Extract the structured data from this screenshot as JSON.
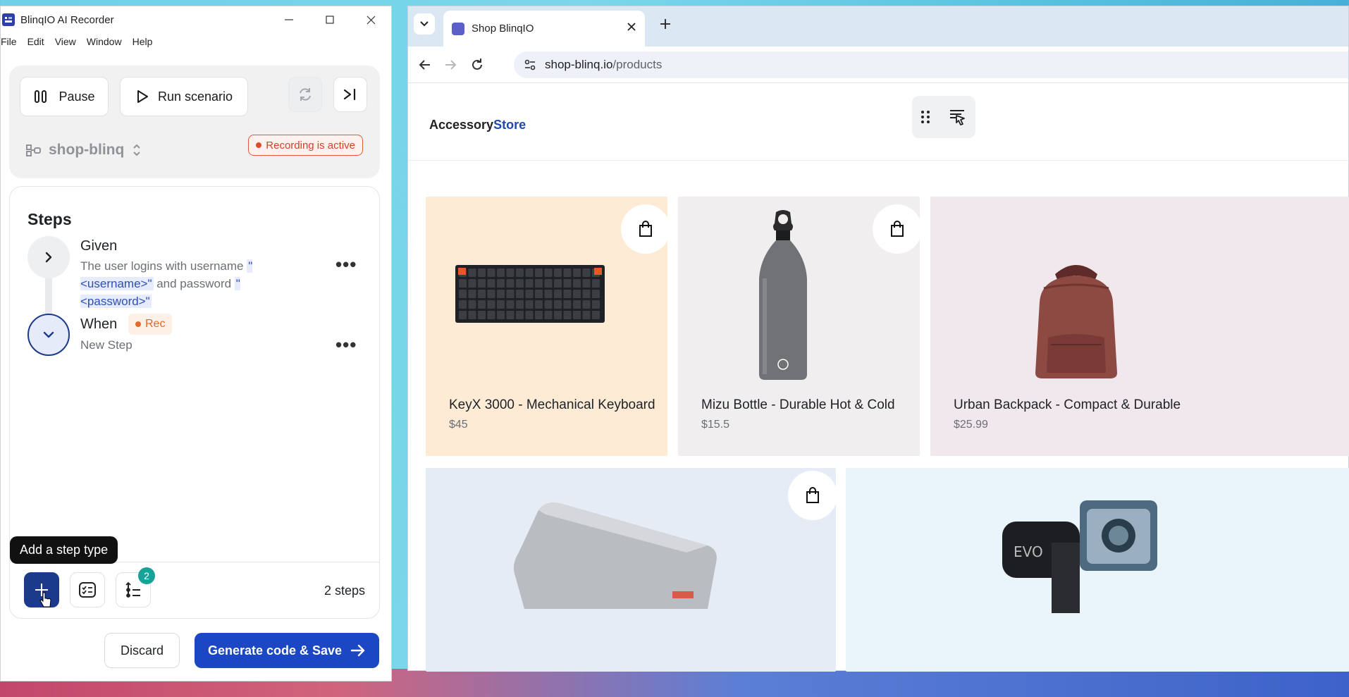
{
  "recorder": {
    "window_title": "BlinqIO AI Recorder",
    "menu": [
      "File",
      "Edit",
      "View",
      "Window",
      "Help"
    ],
    "pause_label": "Pause",
    "run_label": "Run scenario",
    "project_name": "shop-blinq",
    "recording_status": "Recording is active",
    "steps_title": "Steps",
    "steps": [
      {
        "keyword": "Given",
        "text_before": "The user logins with username ",
        "param1": "\"<username>\"",
        "text_mid": " and password ",
        "param2": "\"<password>\""
      },
      {
        "keyword": "When",
        "badge": "Rec",
        "text": "New Step"
      }
    ],
    "tooltip": "Add a step type",
    "step_count_badge": "2",
    "steps_count": "2 steps",
    "discard_label": "Discard",
    "generate_label": "Generate code & Save"
  },
  "browser": {
    "tab_title": "Shop BlinqIO",
    "url_host": "shop-blinq.io",
    "url_path": "/products"
  },
  "store": {
    "logo_main": "Accessory",
    "logo_accent": "Store",
    "products": [
      {
        "name": "KeyX 3000 - Mechanical Keyboard",
        "price": "$45",
        "bg": "#fdebd6"
      },
      {
        "name": "Mizu Bottle - Durable Hot & Cold",
        "price": "$15.5",
        "bg": "#f0eeee"
      },
      {
        "name": "Urban Backpack - Compact & Durable",
        "price": "$25.99",
        "bg": "#f1e8ee"
      }
    ]
  },
  "colors": {
    "accent": "#1b46c4",
    "rec": "#e04a2f",
    "badge": "#16a39a"
  }
}
